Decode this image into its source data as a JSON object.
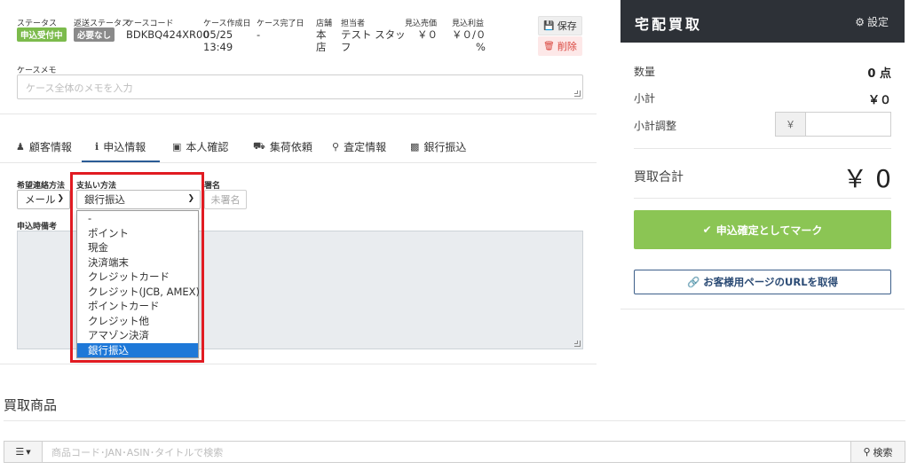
{
  "header": {
    "status_label": "ステータス",
    "status_badge": "申込受付中",
    "return_status_label": "返送ステータス",
    "return_status_badge": "必要なし",
    "case_code_label": "ケースコード",
    "case_code": "BDKBQ424XR00",
    "created_label": "ケース作成日",
    "created_date": "05/25",
    "created_time": "13:49",
    "completed_label": "ケース完了日",
    "completed_value": "-",
    "store_label": "店舗",
    "store_value_1": "本",
    "store_value_2": "店",
    "staff_label": "担当者",
    "staff_value_1": "テスト スタッ",
    "staff_value_2": "フ",
    "est_sales_label": "見込売価",
    "est_sales_value": "￥０",
    "est_profit_label": "見込利益",
    "est_profit_value_1": "￥０/０",
    "est_profit_value_2": "%",
    "save_label": "保存",
    "delete_label": "削除"
  },
  "memo": {
    "label": "ケースメモ",
    "placeholder": "ケース全体のメモを入力"
  },
  "tabs": [
    {
      "label": "顧客情報",
      "icon": "user-icon"
    },
    {
      "label": "申込情報",
      "icon": "info-icon"
    },
    {
      "label": "本人確認",
      "icon": "id-card-icon"
    },
    {
      "label": "集荷依頼",
      "icon": "truck-icon"
    },
    {
      "label": "査定情報",
      "icon": "search-icon"
    },
    {
      "label": "銀行振込",
      "icon": "money-icon"
    }
  ],
  "form": {
    "contact_label": "希望連絡方法",
    "contact_value": "メール",
    "payment_label": "支払い方法",
    "payment_value": "銀行振込",
    "sign_label": "署名",
    "sign_button": "未署名",
    "remark_label": "申込時備考"
  },
  "payment_options": [
    "-",
    "ポイント",
    "現金",
    "決済端末",
    "クレジットカード",
    "クレジット(JCB, AMEX)",
    "ポイントカード",
    "クレジット他",
    "アマゾン決済",
    "銀行振込"
  ],
  "products": {
    "title": "買取商品",
    "search_placeholder": "商品コード･JAN･ASIN･タイトルで検索",
    "search_button": "検索"
  },
  "panel": {
    "title": "宅配買取",
    "settings_label": "設定",
    "qty_label": "数量",
    "qty_value": "0 点",
    "subtotal_label": "小計",
    "subtotal_value": "￥０",
    "adjust_label": "小計調整",
    "adjust_prefix": "￥",
    "total_label": "買取合計",
    "total_value": "￥ 0",
    "confirm_button": "申込確定としてマーク",
    "url_button": "お客様用ページのURLを取得"
  },
  "colors": {
    "status_badge": "#7cbb4c",
    "return_badge": "#8a8a8a",
    "panel_header": "#2d3137",
    "confirm_button": "#8bc554",
    "selected_option": "#1e78d8",
    "highlight": "#e11b22",
    "delete": "#d9443c"
  }
}
